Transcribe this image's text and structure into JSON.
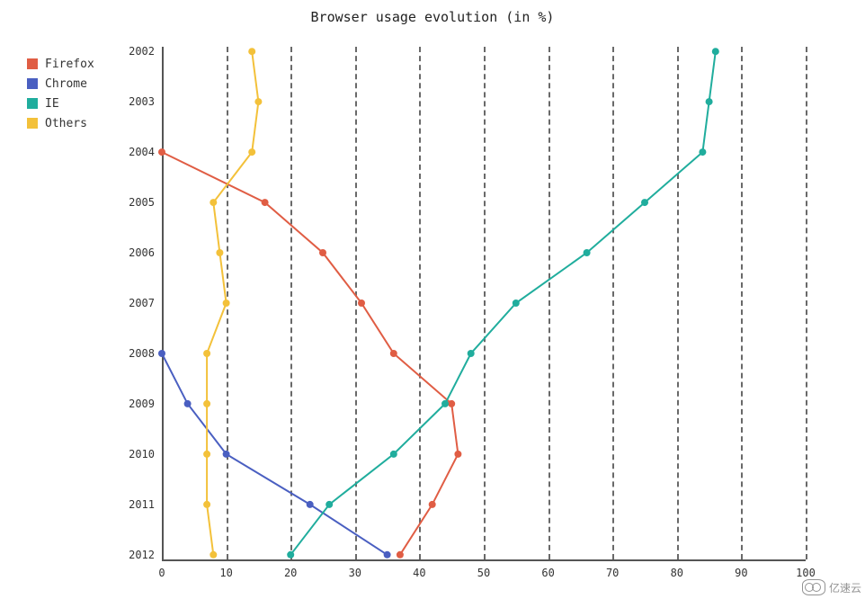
{
  "watermark": "亿速云",
  "chart_data": {
    "type": "line",
    "title": "Browser usage evolution (in %)",
    "xlabel": "",
    "ylabel": "",
    "xlim": [
      0,
      100
    ],
    "x_ticks": [
      0,
      10,
      20,
      30,
      40,
      50,
      60,
      70,
      80,
      90,
      100
    ],
    "categories": [
      "2002",
      "2003",
      "2004",
      "2005",
      "2006",
      "2007",
      "2008",
      "2009",
      "2010",
      "2011",
      "2012"
    ],
    "legend_position": "outside-left",
    "grid": {
      "x": true,
      "y": false,
      "style": "dashed"
    },
    "colors": {
      "Firefox": "#e05d44",
      "Chrome": "#4a5fc1",
      "IE": "#20ad9d",
      "Others": "#f3c13a"
    },
    "series": [
      {
        "name": "Firefox",
        "values": [
          null,
          null,
          0,
          16,
          25,
          31,
          36,
          45,
          46,
          42,
          37
        ]
      },
      {
        "name": "Chrome",
        "values": [
          null,
          null,
          null,
          null,
          null,
          null,
          0,
          4,
          10,
          23,
          35
        ]
      },
      {
        "name": "IE",
        "values": [
          86,
          85,
          84,
          75,
          66,
          55,
          48,
          44,
          36,
          26,
          20
        ]
      },
      {
        "name": "Others",
        "values": [
          14,
          15,
          14,
          8,
          9,
          10,
          7,
          7,
          7,
          7,
          8
        ]
      }
    ]
  }
}
